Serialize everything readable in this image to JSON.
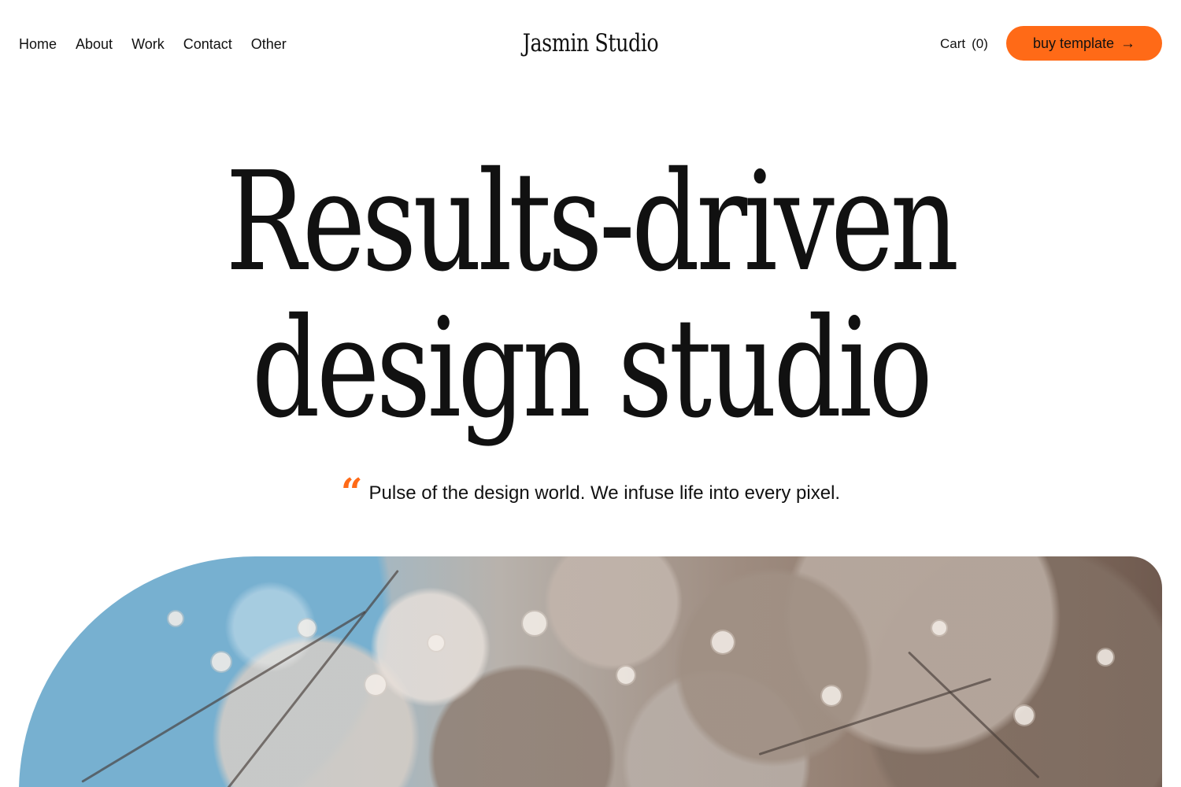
{
  "header": {
    "nav": [
      {
        "label": "Home"
      },
      {
        "label": "About"
      },
      {
        "label": "Work"
      },
      {
        "label": "Contact"
      },
      {
        "label": "Other"
      }
    ],
    "brand": "Jasmin Studio",
    "cart_label": "Cart",
    "cart_count": "(0)",
    "buy_label": "buy template",
    "buy_icon": "arrow-right-icon"
  },
  "hero": {
    "title_line1": "Results-driven",
    "title_line2": "design studio",
    "quote_icon": "quote-icon",
    "quote_text": "Pulse of the design world. We infuse life into every pixel."
  },
  "colors": {
    "accent": "#ff6a17",
    "text": "#111111",
    "background": "#ffffff"
  }
}
